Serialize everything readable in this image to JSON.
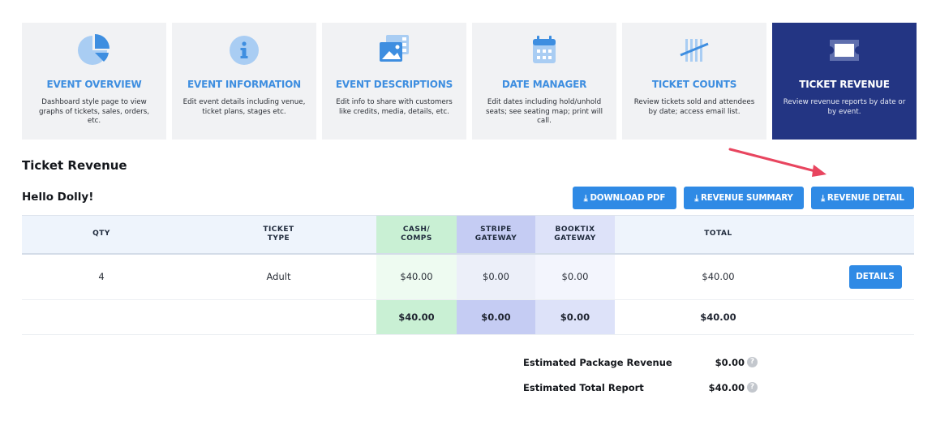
{
  "tiles": [
    {
      "title": "EVENT OVERVIEW",
      "desc": "Dashboard style page to view graphs of tickets, sales, orders, etc.",
      "icon": "pie-chart-icon"
    },
    {
      "title": "EVENT INFORMATION",
      "desc": "Edit event details including venue, ticket plans, stages etc.",
      "icon": "info-icon"
    },
    {
      "title": "EVENT DESCRIPTIONS",
      "desc": "Edit info to share with customers like credits, media, details, etc.",
      "icon": "images-icon"
    },
    {
      "title": "DATE MANAGER",
      "desc": "Edit dates including hold/unhold seats; see seating map; print will call.",
      "icon": "calendar-icon"
    },
    {
      "title": "TICKET COUNTS",
      "desc": "Review tickets sold and attendees by date; access email list.",
      "icon": "tally-icon"
    },
    {
      "title": "TICKET REVENUE",
      "desc": "Review revenue reports by date or by event.",
      "icon": "ticket-icon"
    }
  ],
  "page": {
    "section_title": "Ticket Revenue",
    "event_name": "Hello Dolly!"
  },
  "buttons": {
    "download_pdf": "DOWNLOAD PDF",
    "revenue_summary": "REVENUE SUMMARY",
    "revenue_detail": "REVENUE DETAIL",
    "download_icon": "download-icon"
  },
  "table": {
    "headers": [
      "QTY",
      "TICKET\nTYPE",
      "CASH/\nCOMPS",
      "STRIPE\nGATEWAY",
      "BOOKTIX\nGATEWAY",
      "TOTAL"
    ],
    "rows": [
      {
        "qty": "4",
        "ticket_type": "Adult",
        "cash": "$40.00",
        "stripe": "$0.00",
        "booktix": "$0.00",
        "total": "$40.00",
        "action": "DETAILS"
      }
    ],
    "totals": {
      "cash": "$40.00",
      "stripe": "$0.00",
      "booktix": "$0.00",
      "total": "$40.00"
    }
  },
  "estimates": [
    {
      "label": "Estimated Package Revenue",
      "value": "$0.00"
    },
    {
      "label": "Estimated Total Report",
      "value": "$40.00"
    }
  ],
  "colors": {
    "accent": "#2f8ae5",
    "active_tile": "#233583",
    "tile_title": "#3e8ee0",
    "arrow": "#e8455f"
  }
}
